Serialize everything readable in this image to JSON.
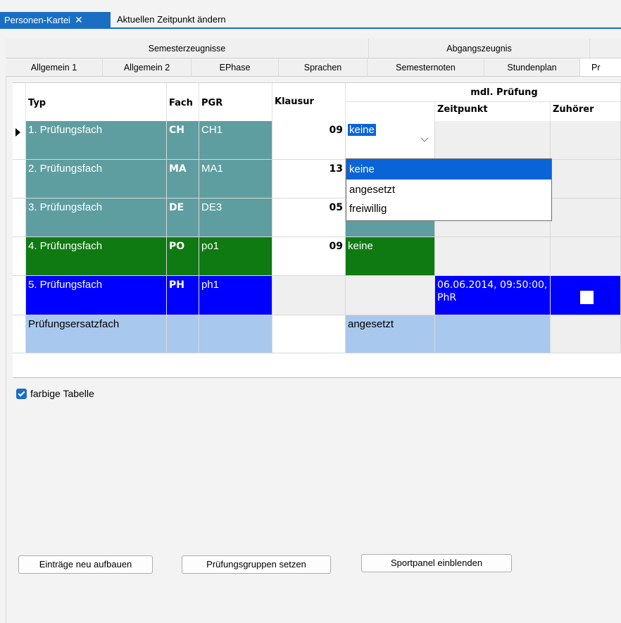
{
  "window_tabs": [
    {
      "label": "Personen-Kartei",
      "close": "✕"
    },
    {
      "label": "Aktuellen Zeitpunkt ändern"
    }
  ],
  "inner_tabs_upper": [
    "Semesterzeugnisse",
    "Abgangszeugnis"
  ],
  "inner_tabs_lower": [
    "Allgemein 1",
    "Allgemein 2",
    "EPhase",
    "Sprachen",
    "Semesternoten",
    "Stundenplan",
    "Pr"
  ],
  "grid": {
    "headers": {
      "typ": "Typ",
      "fach": "Fach",
      "pgr": "PGR",
      "klausur": "Klausur",
      "mdl": "mdl. Prüfung",
      "zeitpunkt": "Zeitpunkt",
      "zuhoerer": "Zuhörer"
    },
    "rows": [
      {
        "typ": "1. Prüfungsfach",
        "fach": "CH",
        "pgr": "CH1",
        "klausur": "09",
        "mdl": "keine",
        "zeitpunkt": "",
        "color": "#5f9ea0"
      },
      {
        "typ": "2. Prüfungsfach",
        "fach": "MA",
        "pgr": "MA1",
        "klausur": "13",
        "mdl": "",
        "zeitpunkt": "",
        "color": "#5f9ea0"
      },
      {
        "typ": "3. Prüfungsfach",
        "fach": "DE",
        "pgr": "DE3",
        "klausur": "05",
        "mdl": "",
        "zeitpunkt": "",
        "color": "#5f9ea0"
      },
      {
        "typ": "4. Prüfungsfach",
        "fach": "PO",
        "pgr": "po1",
        "klausur": "09",
        "mdl": "keine",
        "zeitpunkt": "",
        "color": "#0f7a12"
      },
      {
        "typ": "5. Prüfungsfach",
        "fach": "PH",
        "pgr": "ph1",
        "klausur": "",
        "mdl": "",
        "zeitpunkt": "06.06.2014, 09:50:00, PhR",
        "zuhoerer_checked": false,
        "color": "#0000ff"
      },
      {
        "typ": "Prüfungsersatzfach",
        "fach": "",
        "pgr": "",
        "klausur": "",
        "mdl": "angesetzt",
        "zeitpunkt": "",
        "color": "#a9c8ee"
      }
    ],
    "dropdown_options": [
      "keine",
      "angesetzt",
      "freiwillig"
    ],
    "dropdown_selected": "keine"
  },
  "colored_table": {
    "label": "farbige Tabelle",
    "checked": true
  },
  "buttons": {
    "rebuild": "Einträge neu aufbauen",
    "set_groups": "Prüfungsgruppen setzen",
    "sport_panel": "Sportpanel einblenden"
  }
}
